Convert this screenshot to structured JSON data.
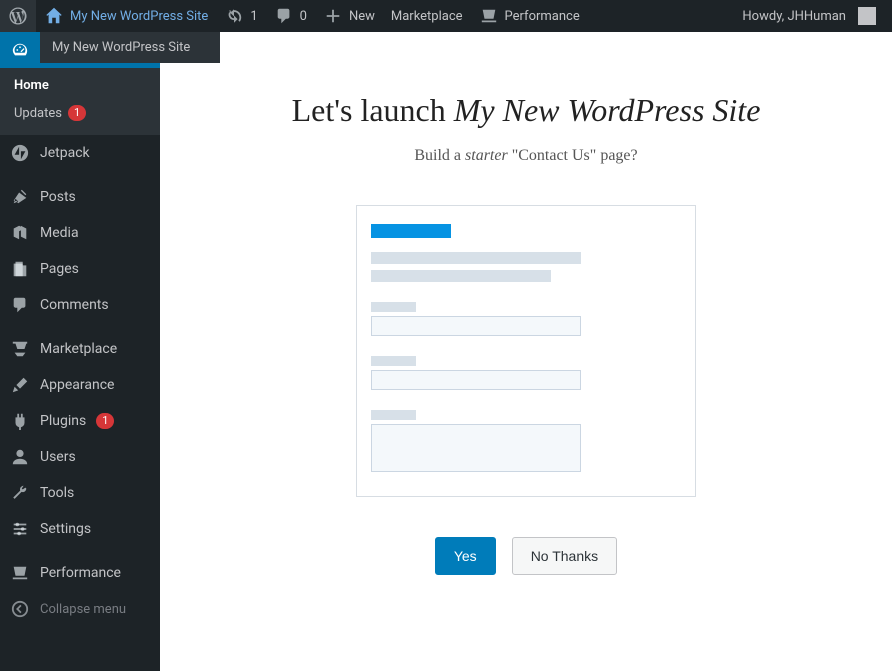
{
  "adminbar": {
    "site_name": "My New WordPress Site",
    "updates_count": "1",
    "comments_count": "0",
    "new_label": "New",
    "marketplace_label": "Marketplace",
    "performance_label": "Performance",
    "greeting": "Howdy, JHHuman"
  },
  "site_dropdown": {
    "item1": "My New WordPress Site"
  },
  "sidebar": {
    "dashboard": {
      "home": "Home",
      "updates": "Updates",
      "updates_count": "1"
    },
    "jetpack": "Jetpack",
    "posts": "Posts",
    "media": "Media",
    "pages": "Pages",
    "comments": "Comments",
    "marketplace": "Marketplace",
    "appearance": "Appearance",
    "plugins": "Plugins",
    "plugins_count": "1",
    "users": "Users",
    "tools": "Tools",
    "settings": "Settings",
    "performance": "Performance",
    "collapse": "Collapse menu"
  },
  "content": {
    "title_prefix": "Let's launch ",
    "title_site": "My New WordPress Site",
    "subtitle_prefix": "Build a ",
    "subtitle_italic": "starter",
    "subtitle_suffix": " \"Contact Us\" page?",
    "yes": "Yes",
    "no": "No Thanks"
  }
}
